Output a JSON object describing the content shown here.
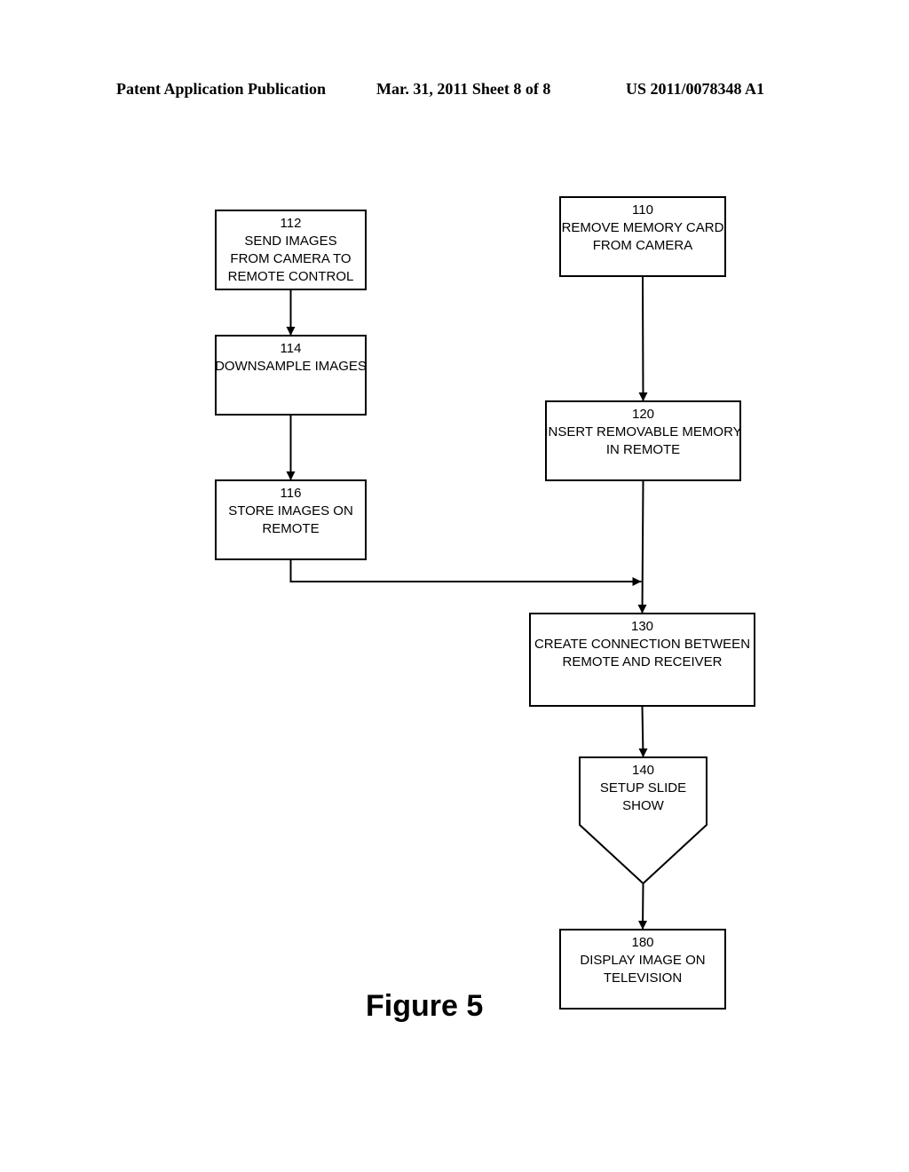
{
  "header": {
    "publication": "Patent Application Publication",
    "date_sheet": "Mar. 31, 2011  Sheet 8 of 8",
    "number": "US 2011/0078348 A1"
  },
  "figure_label": "Figure 5",
  "flowchart": {
    "nodes": [
      {
        "id": "112",
        "shape": "rect",
        "lines": [
          "112",
          "SEND IMAGES",
          "FROM CAMERA TO",
          "REMOTE CONTROL"
        ]
      },
      {
        "id": "114",
        "shape": "rect",
        "lines": [
          "114",
          "DOWNSAMPLE IMAGES"
        ]
      },
      {
        "id": "116",
        "shape": "rect",
        "lines": [
          "116",
          "STORE IMAGES ON",
          "REMOTE"
        ]
      },
      {
        "id": "110",
        "shape": "rect",
        "lines": [
          "110",
          "REMOVE MEMORY CARD",
          "FROM CAMERA"
        ]
      },
      {
        "id": "120",
        "shape": "rect",
        "lines": [
          "120",
          "INSERT REMOVABLE MEMORY",
          "IN REMOTE"
        ]
      },
      {
        "id": "130",
        "shape": "rect",
        "lines": [
          "130",
          "CREATE CONNECTION BETWEEN",
          "REMOTE AND RECEIVER"
        ]
      },
      {
        "id": "140",
        "shape": "pentagon",
        "lines": [
          "140",
          "SETUP SLIDE",
          "SHOW"
        ]
      },
      {
        "id": "180",
        "shape": "rect",
        "lines": [
          "180",
          "DISPLAY IMAGE ON",
          "TELEVISION"
        ]
      }
    ],
    "edges": [
      {
        "from": "112",
        "to": "114"
      },
      {
        "from": "114",
        "to": "116"
      },
      {
        "from": "110",
        "to": "120"
      },
      {
        "from": "120",
        "to": "130"
      },
      {
        "from": "116",
        "to": "130"
      },
      {
        "from": "130",
        "to": "140"
      },
      {
        "from": "140",
        "to": "180"
      }
    ]
  }
}
